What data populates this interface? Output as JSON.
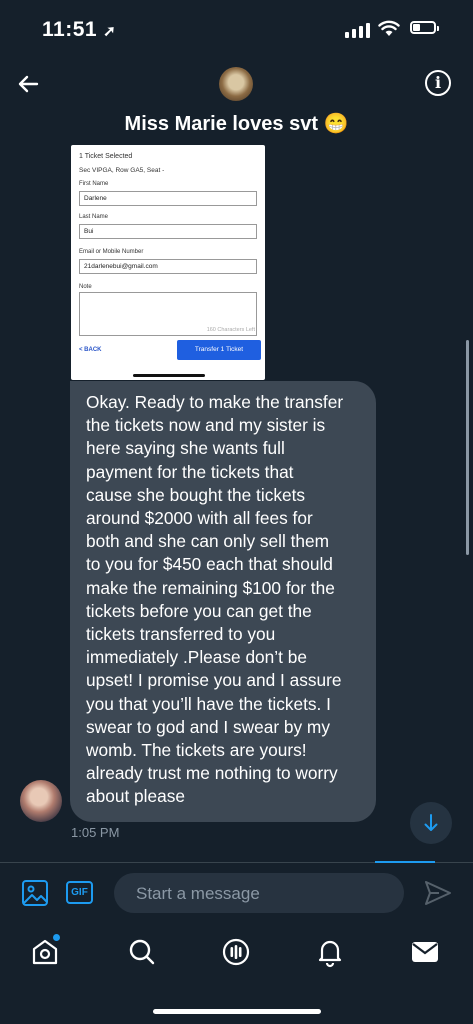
{
  "status_bar": {
    "time": "11:51",
    "battery_level": 0.3
  },
  "header": {
    "title": "Miss Marie loves svt 😁",
    "back_icon": "arrow-left-icon",
    "info_icon": "info-icon"
  },
  "attachment": {
    "tickets_selected": "1 Ticket Selected",
    "seat_info": "Sec VIPGA, Row GA5, Seat -",
    "first_name_label": "First Name",
    "first_name_value": "Darlene",
    "last_name_label": "Last Name",
    "last_name_value": "Bui",
    "email_label": "Email or Mobile Number",
    "email_value": "21darlenebui@gmail.com",
    "note_label": "Note",
    "chars_left": "160 Characters Left",
    "back_label": "< BACK",
    "transfer_label": "Transfer 1 Ticket"
  },
  "message": {
    "text": "Okay. Ready to make the transfer\nthe tickets now and my sister is\nhere saying she wants full\npayment for the tickets that\ncause she bought the tickets\naround $2000 with all fees for\nboth  and she can only sell them\nto you for $450 each that should\nmake the remaining $100 for the\ntickets before you can get the\ntickets transferred to you\nimmediately .Please don’t be\nupset!  I promise you and I assure\nyou that you’ll have the tickets. I\nswear to god and I swear by my\nwomb. The tickets are yours!\nalready trust me nothing to worry\nabout please",
    "timestamp": "1:05 PM"
  },
  "composer": {
    "placeholder": "Start a message",
    "gif_label": "GIF"
  },
  "nav": {
    "items": [
      "home-icon",
      "search-icon",
      "spaces-icon",
      "notifications-icon",
      "messages-icon"
    ]
  },
  "colors": {
    "background": "#15202b",
    "bubble": "#3d4854",
    "accent": "#1d9bf0"
  }
}
